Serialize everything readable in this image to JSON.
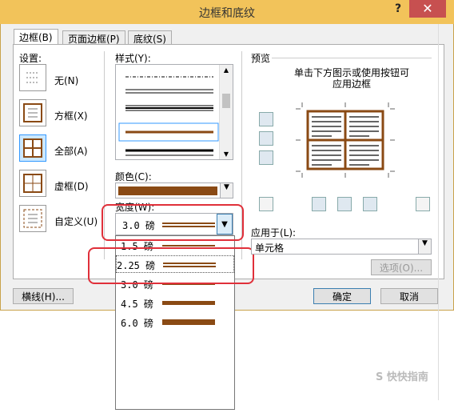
{
  "window": {
    "title": "边框和底纹",
    "help": "?",
    "close": "✕"
  },
  "tabs": [
    {
      "label": "边框(B)"
    },
    {
      "label": "页面边框(P)"
    },
    {
      "label": "底纹(S)"
    }
  ],
  "settings": {
    "label": "设置:",
    "items": [
      {
        "label": "无(N)",
        "icon": "none-icon"
      },
      {
        "label": "方框(X)",
        "icon": "box-icon"
      },
      {
        "label": "全部(A)",
        "icon": "all-icon"
      },
      {
        "label": "虚框(D)",
        "icon": "grid-icon"
      },
      {
        "label": "自定义(U)",
        "icon": "custom-icon"
      }
    ]
  },
  "style": {
    "label": "样式(Y):"
  },
  "color": {
    "label": "颜色(C):",
    "value_color": "#8a4a14"
  },
  "width": {
    "label": "宽度(W):",
    "selected": "3.0 磅",
    "options": [
      "1.5 磅",
      "2.25 磅",
      "3.0 磅",
      "4.5 磅",
      "6.0 磅"
    ]
  },
  "preview": {
    "label": "预览",
    "hint_line1": "单击下方图示或使用按钮可",
    "hint_line2": "应用边框",
    "border_color": "#8a4a14"
  },
  "apply_to": {
    "label": "应用于(L):",
    "value": "单元格"
  },
  "buttons": {
    "options": "选项(O)...",
    "horizontal_line": "横线(H)...",
    "ok": "确定",
    "cancel": "取消"
  },
  "watermark": "S 快快指南"
}
